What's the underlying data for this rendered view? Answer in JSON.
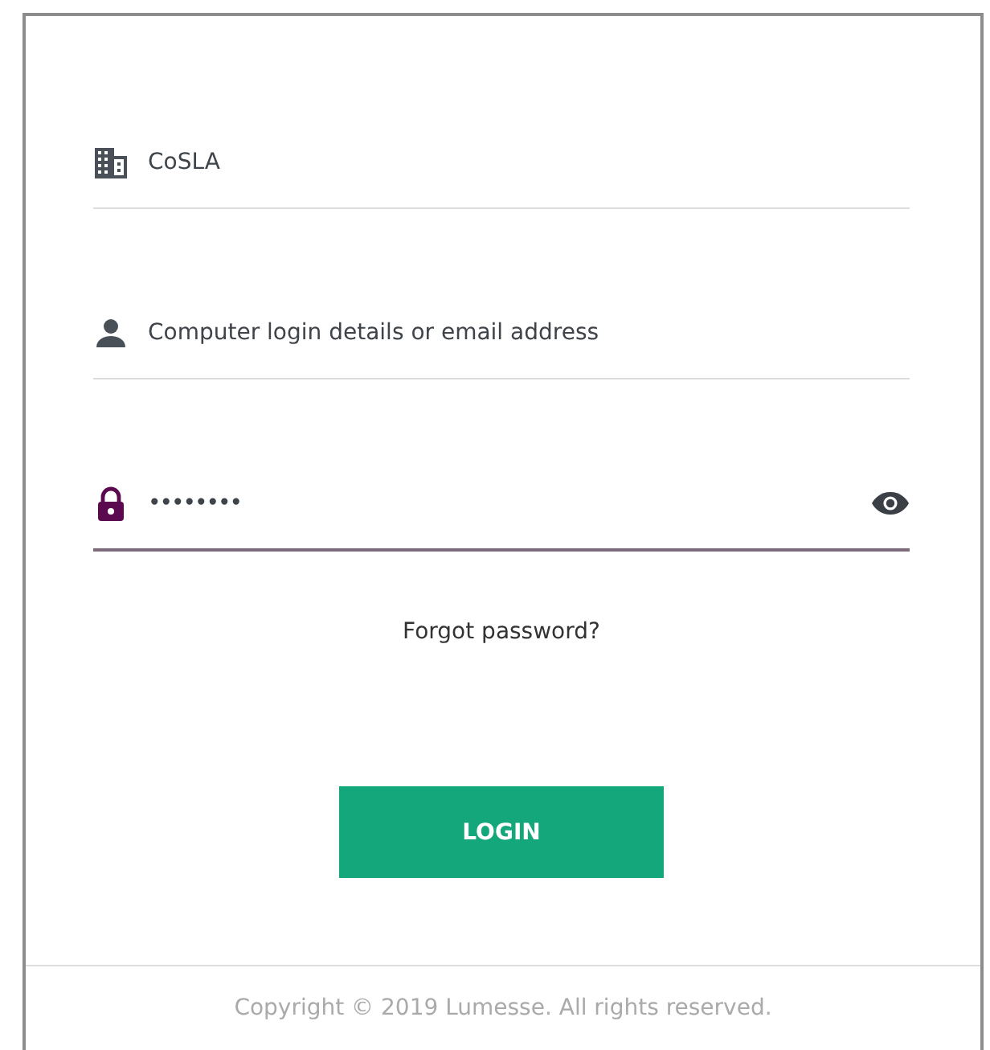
{
  "fields": [
    {
      "kind": "organisation",
      "value": "CoSLA",
      "focused": false
    },
    {
      "kind": "user",
      "placeholder": "Computer login details or email address",
      "focused": false
    },
    {
      "kind": "password",
      "value": "••••••••",
      "focused": true
    }
  ],
  "forgot_link": "Forgot password?",
  "login_button": "LOGIN",
  "footer": "Copyright © 2019 Lumesse. All rights reserved."
}
